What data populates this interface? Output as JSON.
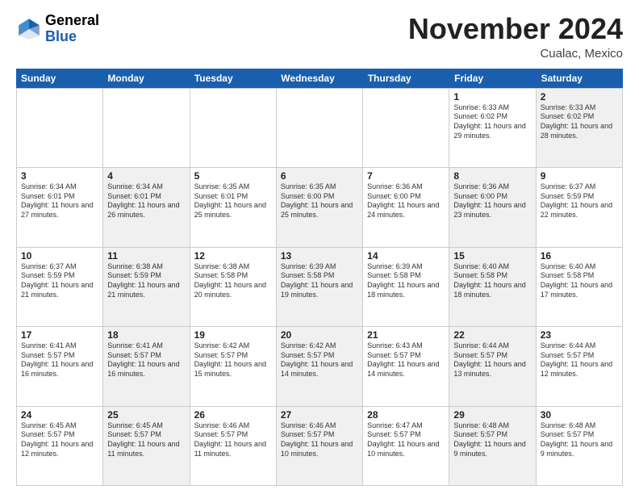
{
  "header": {
    "logo_general": "General",
    "logo_blue": "Blue",
    "month_title": "November 2024",
    "location": "Cualac, Mexico"
  },
  "weekdays": [
    "Sunday",
    "Monday",
    "Tuesday",
    "Wednesday",
    "Thursday",
    "Friday",
    "Saturday"
  ],
  "rows": [
    [
      {
        "day": "",
        "empty": true,
        "shaded": false
      },
      {
        "day": "",
        "empty": true,
        "shaded": false
      },
      {
        "day": "",
        "empty": true,
        "shaded": false
      },
      {
        "day": "",
        "empty": true,
        "shaded": false
      },
      {
        "day": "",
        "empty": true,
        "shaded": false
      },
      {
        "day": "1",
        "empty": false,
        "shaded": false,
        "sunrise": "Sunrise: 6:33 AM",
        "sunset": "Sunset: 6:02 PM",
        "daylight": "Daylight: 11 hours and 29 minutes."
      },
      {
        "day": "2",
        "empty": false,
        "shaded": true,
        "sunrise": "Sunrise: 6:33 AM",
        "sunset": "Sunset: 6:02 PM",
        "daylight": "Daylight: 11 hours and 28 minutes."
      }
    ],
    [
      {
        "day": "3",
        "empty": false,
        "shaded": false,
        "sunrise": "Sunrise: 6:34 AM",
        "sunset": "Sunset: 6:01 PM",
        "daylight": "Daylight: 11 hours and 27 minutes."
      },
      {
        "day": "4",
        "empty": false,
        "shaded": true,
        "sunrise": "Sunrise: 6:34 AM",
        "sunset": "Sunset: 6:01 PM",
        "daylight": "Daylight: 11 hours and 26 minutes."
      },
      {
        "day": "5",
        "empty": false,
        "shaded": false,
        "sunrise": "Sunrise: 6:35 AM",
        "sunset": "Sunset: 6:01 PM",
        "daylight": "Daylight: 11 hours and 25 minutes."
      },
      {
        "day": "6",
        "empty": false,
        "shaded": true,
        "sunrise": "Sunrise: 6:35 AM",
        "sunset": "Sunset: 6:00 PM",
        "daylight": "Daylight: 11 hours and 25 minutes."
      },
      {
        "day": "7",
        "empty": false,
        "shaded": false,
        "sunrise": "Sunrise: 6:36 AM",
        "sunset": "Sunset: 6:00 PM",
        "daylight": "Daylight: 11 hours and 24 minutes."
      },
      {
        "day": "8",
        "empty": false,
        "shaded": true,
        "sunrise": "Sunrise: 6:36 AM",
        "sunset": "Sunset: 6:00 PM",
        "daylight": "Daylight: 11 hours and 23 minutes."
      },
      {
        "day": "9",
        "empty": false,
        "shaded": false,
        "sunrise": "Sunrise: 6:37 AM",
        "sunset": "Sunset: 5:59 PM",
        "daylight": "Daylight: 11 hours and 22 minutes."
      }
    ],
    [
      {
        "day": "10",
        "empty": false,
        "shaded": false,
        "sunrise": "Sunrise: 6:37 AM",
        "sunset": "Sunset: 5:59 PM",
        "daylight": "Daylight: 11 hours and 21 minutes."
      },
      {
        "day": "11",
        "empty": false,
        "shaded": true,
        "sunrise": "Sunrise: 6:38 AM",
        "sunset": "Sunset: 5:59 PM",
        "daylight": "Daylight: 11 hours and 21 minutes."
      },
      {
        "day": "12",
        "empty": false,
        "shaded": false,
        "sunrise": "Sunrise: 6:38 AM",
        "sunset": "Sunset: 5:58 PM",
        "daylight": "Daylight: 11 hours and 20 minutes."
      },
      {
        "day": "13",
        "empty": false,
        "shaded": true,
        "sunrise": "Sunrise: 6:39 AM",
        "sunset": "Sunset: 5:58 PM",
        "daylight": "Daylight: 11 hours and 19 minutes."
      },
      {
        "day": "14",
        "empty": false,
        "shaded": false,
        "sunrise": "Sunrise: 6:39 AM",
        "sunset": "Sunset: 5:58 PM",
        "daylight": "Daylight: 11 hours and 18 minutes."
      },
      {
        "day": "15",
        "empty": false,
        "shaded": true,
        "sunrise": "Sunrise: 6:40 AM",
        "sunset": "Sunset: 5:58 PM",
        "daylight": "Daylight: 11 hours and 18 minutes."
      },
      {
        "day": "16",
        "empty": false,
        "shaded": false,
        "sunrise": "Sunrise: 6:40 AM",
        "sunset": "Sunset: 5:58 PM",
        "daylight": "Daylight: 11 hours and 17 minutes."
      }
    ],
    [
      {
        "day": "17",
        "empty": false,
        "shaded": false,
        "sunrise": "Sunrise: 6:41 AM",
        "sunset": "Sunset: 5:57 PM",
        "daylight": "Daylight: 11 hours and 16 minutes."
      },
      {
        "day": "18",
        "empty": false,
        "shaded": true,
        "sunrise": "Sunrise: 6:41 AM",
        "sunset": "Sunset: 5:57 PM",
        "daylight": "Daylight: 11 hours and 16 minutes."
      },
      {
        "day": "19",
        "empty": false,
        "shaded": false,
        "sunrise": "Sunrise: 6:42 AM",
        "sunset": "Sunset: 5:57 PM",
        "daylight": "Daylight: 11 hours and 15 minutes."
      },
      {
        "day": "20",
        "empty": false,
        "shaded": true,
        "sunrise": "Sunrise: 6:42 AM",
        "sunset": "Sunset: 5:57 PM",
        "daylight": "Daylight: 11 hours and 14 minutes."
      },
      {
        "day": "21",
        "empty": false,
        "shaded": false,
        "sunrise": "Sunrise: 6:43 AM",
        "sunset": "Sunset: 5:57 PM",
        "daylight": "Daylight: 11 hours and 14 minutes."
      },
      {
        "day": "22",
        "empty": false,
        "shaded": true,
        "sunrise": "Sunrise: 6:44 AM",
        "sunset": "Sunset: 5:57 PM",
        "daylight": "Daylight: 11 hours and 13 minutes."
      },
      {
        "day": "23",
        "empty": false,
        "shaded": false,
        "sunrise": "Sunrise: 6:44 AM",
        "sunset": "Sunset: 5:57 PM",
        "daylight": "Daylight: 11 hours and 12 minutes."
      }
    ],
    [
      {
        "day": "24",
        "empty": false,
        "shaded": false,
        "sunrise": "Sunrise: 6:45 AM",
        "sunset": "Sunset: 5:57 PM",
        "daylight": "Daylight: 11 hours and 12 minutes."
      },
      {
        "day": "25",
        "empty": false,
        "shaded": true,
        "sunrise": "Sunrise: 6:45 AM",
        "sunset": "Sunset: 5:57 PM",
        "daylight": "Daylight: 11 hours and 11 minutes."
      },
      {
        "day": "26",
        "empty": false,
        "shaded": false,
        "sunrise": "Sunrise: 6:46 AM",
        "sunset": "Sunset: 5:57 PM",
        "daylight": "Daylight: 11 hours and 11 minutes."
      },
      {
        "day": "27",
        "empty": false,
        "shaded": true,
        "sunrise": "Sunrise: 6:46 AM",
        "sunset": "Sunset: 5:57 PM",
        "daylight": "Daylight: 11 hours and 10 minutes."
      },
      {
        "day": "28",
        "empty": false,
        "shaded": false,
        "sunrise": "Sunrise: 6:47 AM",
        "sunset": "Sunset: 5:57 PM",
        "daylight": "Daylight: 11 hours and 10 minutes."
      },
      {
        "day": "29",
        "empty": false,
        "shaded": true,
        "sunrise": "Sunrise: 6:48 AM",
        "sunset": "Sunset: 5:57 PM",
        "daylight": "Daylight: 11 hours and 9 minutes."
      },
      {
        "day": "30",
        "empty": false,
        "shaded": false,
        "sunrise": "Sunrise: 6:48 AM",
        "sunset": "Sunset: 5:57 PM",
        "daylight": "Daylight: 11 hours and 9 minutes."
      }
    ]
  ]
}
